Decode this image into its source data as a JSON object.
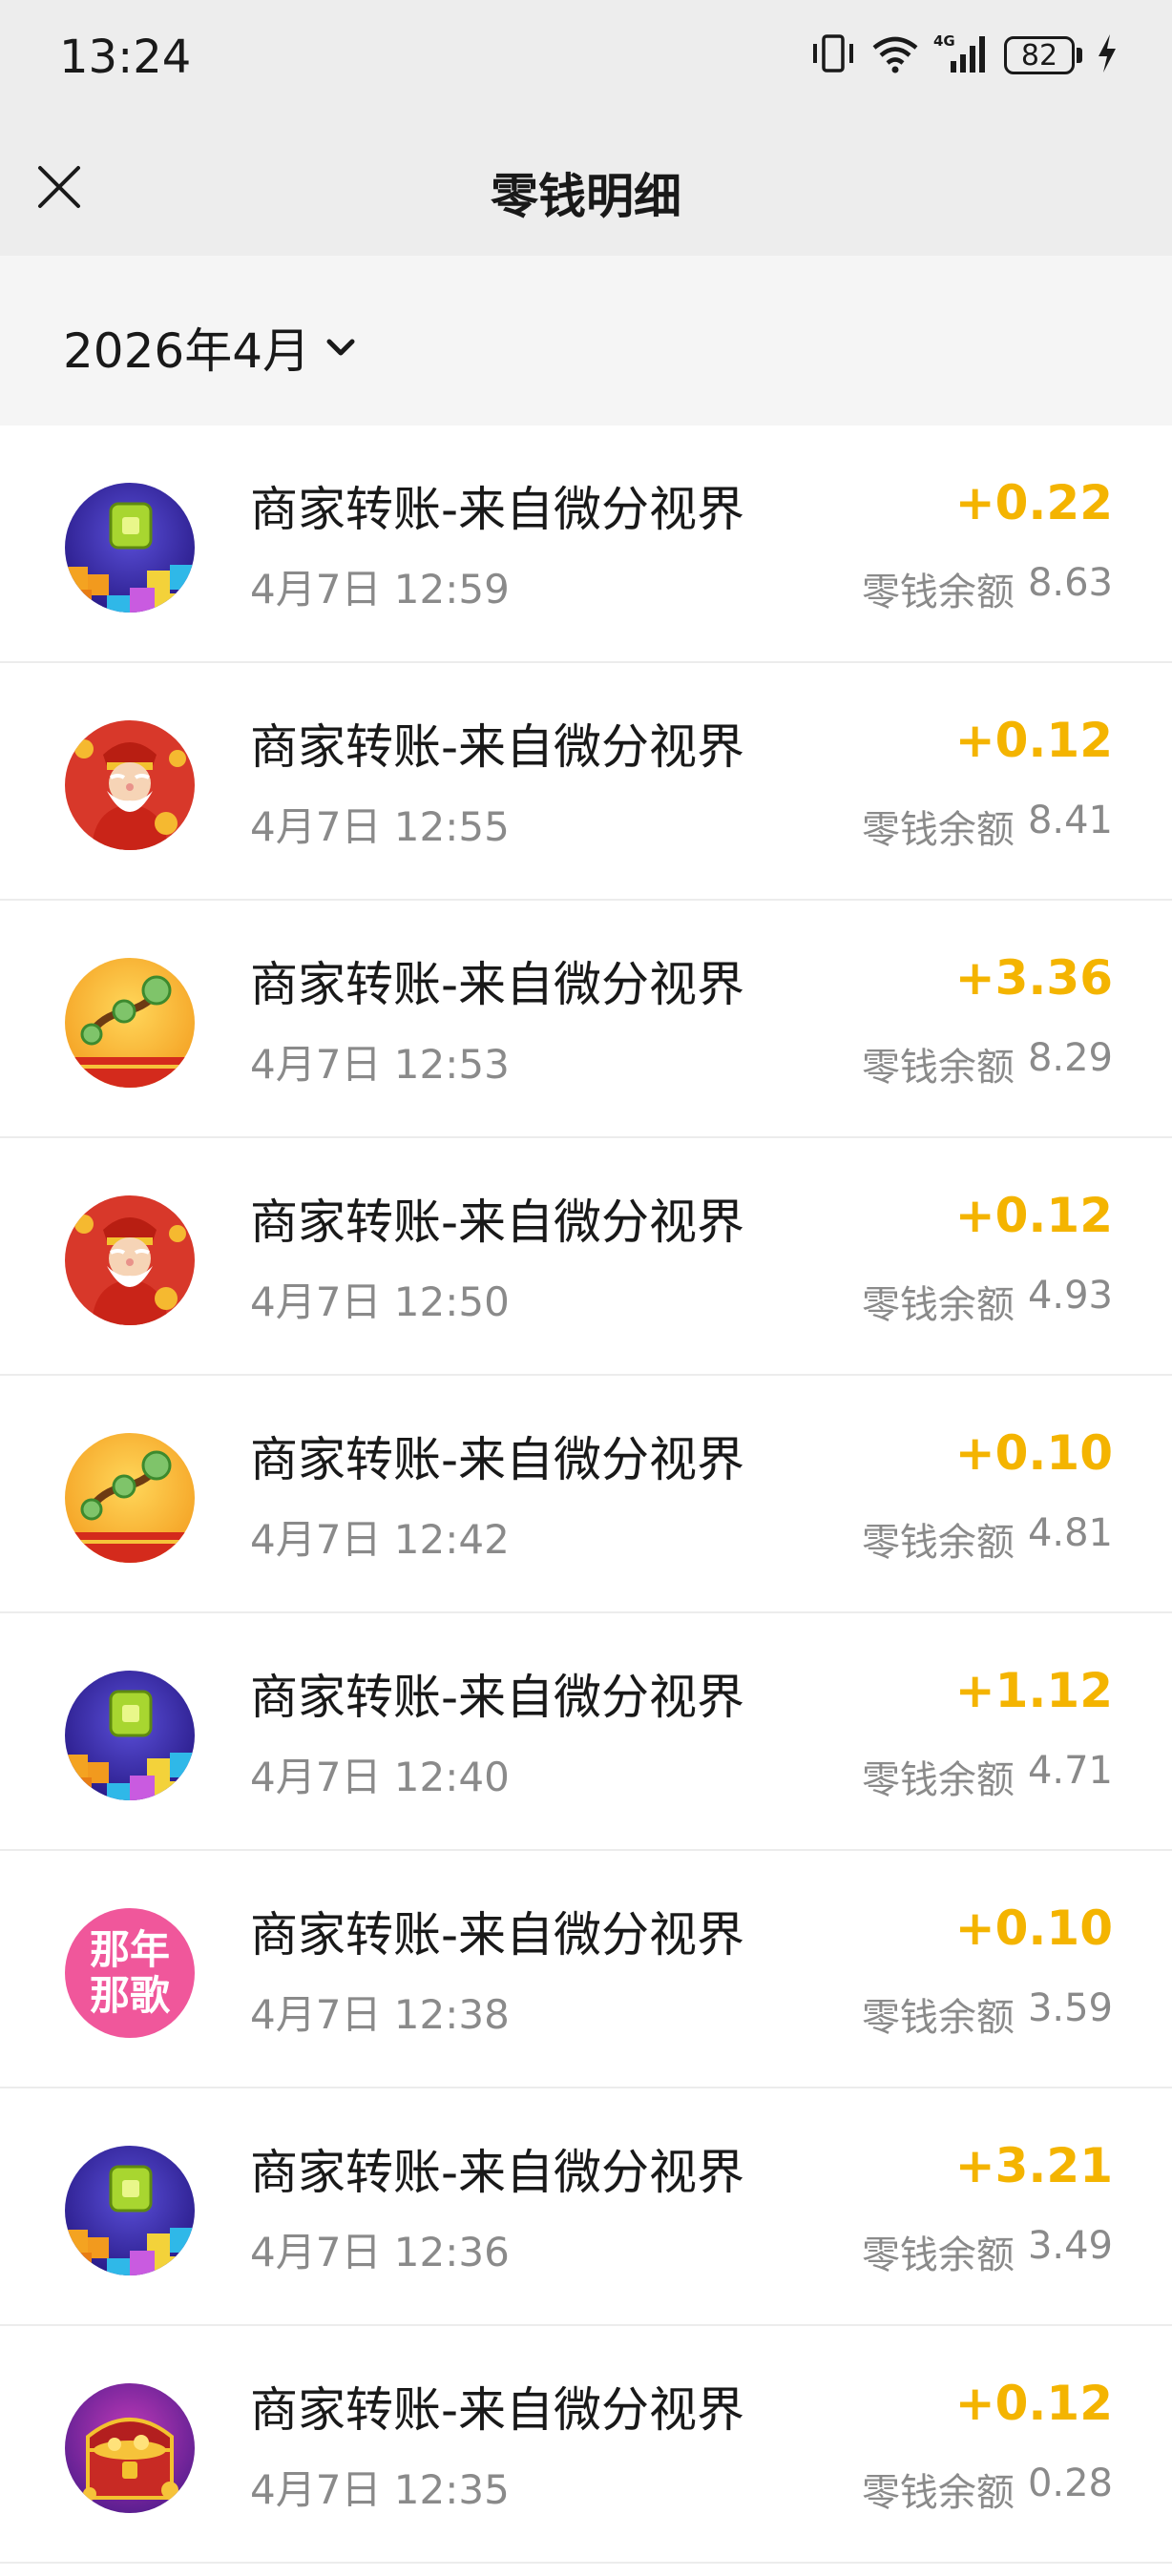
{
  "status_bar": {
    "time": "13:24",
    "network": "4G",
    "battery": "82"
  },
  "nav": {
    "title": "零钱明细",
    "close_icon": "close-icon"
  },
  "month_filter": {
    "label": "2026年4月",
    "icon": "chevron-down-icon"
  },
  "colors": {
    "amount": "#f4b400",
    "secondary_text": "#8a8a8a",
    "header_bg": "#ededed"
  },
  "transactions": [
    {
      "title": "商家转账-来自微分视界",
      "time": "4月7日 12:59",
      "amount": "+0.22",
      "balance_label": "零钱余额",
      "balance": "8.63",
      "avatar": "block-game-avatar"
    },
    {
      "title": "商家转账-来自微分视界",
      "time": "4月7日 12:55",
      "amount": "+0.12",
      "balance_label": "零钱余额",
      "balance": "8.41",
      "avatar": "fortune-god-avatar"
    },
    {
      "title": "商家转账-来自微分视界",
      "time": "4月7日 12:53",
      "amount": "+3.36",
      "balance_label": "零钱余额",
      "balance": "8.29",
      "avatar": "ruyi-avatar"
    },
    {
      "title": "商家转账-来自微分视界",
      "time": "4月7日 12:50",
      "amount": "+0.12",
      "balance_label": "零钱余额",
      "balance": "4.93",
      "avatar": "fortune-god-avatar"
    },
    {
      "title": "商家转账-来自微分视界",
      "time": "4月7日 12:42",
      "amount": "+0.10",
      "balance_label": "零钱余额",
      "balance": "4.81",
      "avatar": "ruyi-avatar"
    },
    {
      "title": "商家转账-来自微分视界",
      "time": "4月7日 12:40",
      "amount": "+1.12",
      "balance_label": "零钱余额",
      "balance": "4.71",
      "avatar": "block-game-avatar"
    },
    {
      "title": "商家转账-来自微分视界",
      "time": "4月7日 12:38",
      "amount": "+0.10",
      "balance_label": "零钱余额",
      "balance": "3.59",
      "avatar": "song-avatar",
      "avatar_text": [
        "那年",
        "那歌"
      ]
    },
    {
      "title": "商家转账-来自微分视界",
      "time": "4月7日 12:36",
      "amount": "+3.21",
      "balance_label": "零钱余额",
      "balance": "3.49",
      "avatar": "block-game-avatar"
    },
    {
      "title": "商家转账-来自微分视界",
      "time": "4月7日 12:35",
      "amount": "+0.12",
      "balance_label": "零钱余额",
      "balance": "0.28",
      "avatar": "treasure-chest-avatar"
    }
  ]
}
